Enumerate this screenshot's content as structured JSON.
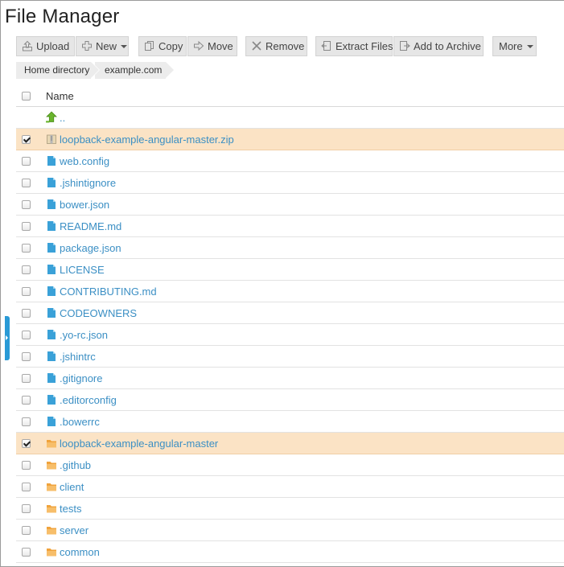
{
  "title": "File Manager",
  "toolbar": {
    "upload": "Upload",
    "new": "New",
    "copy": "Copy",
    "move": "Move",
    "remove": "Remove",
    "extract": "Extract Files",
    "archive": "Add to Archive",
    "more": "More"
  },
  "breadcrumb": [
    "Home directory",
    "example.com"
  ],
  "table": {
    "header_name": "Name",
    "parent": ".."
  },
  "files": [
    {
      "name": "loopback-example-angular-master.zip",
      "type": "zip",
      "selected": true
    },
    {
      "name": "web.config",
      "type": "file",
      "selected": false
    },
    {
      "name": ".jshintignore",
      "type": "file",
      "selected": false
    },
    {
      "name": "bower.json",
      "type": "file",
      "selected": false
    },
    {
      "name": "README.md",
      "type": "file",
      "selected": false
    },
    {
      "name": "package.json",
      "type": "file",
      "selected": false
    },
    {
      "name": "LICENSE",
      "type": "file",
      "selected": false
    },
    {
      "name": "CONTRIBUTING.md",
      "type": "file",
      "selected": false
    },
    {
      "name": "CODEOWNERS",
      "type": "file",
      "selected": false
    },
    {
      "name": ".yo-rc.json",
      "type": "file",
      "selected": false
    },
    {
      "name": ".jshintrc",
      "type": "file",
      "selected": false
    },
    {
      "name": ".gitignore",
      "type": "file",
      "selected": false
    },
    {
      "name": ".editorconfig",
      "type": "file",
      "selected": false
    },
    {
      "name": ".bowerrc",
      "type": "file",
      "selected": false
    },
    {
      "name": "loopback-example-angular-master",
      "type": "folder",
      "selected": true
    },
    {
      "name": ".github",
      "type": "folder",
      "selected": false
    },
    {
      "name": "client",
      "type": "folder",
      "selected": false
    },
    {
      "name": "tests",
      "type": "folder",
      "selected": false
    },
    {
      "name": "server",
      "type": "folder",
      "selected": false
    },
    {
      "name": "common",
      "type": "folder",
      "selected": false
    }
  ],
  "colors": {
    "link": "#3b8fc4",
    "selected_row": "#fbe3c5",
    "file_icon": "#3aa1d8",
    "folder_icon": "#f0a33c",
    "up_icon": "#6ab52d",
    "side_tab": "#2a9ad6"
  }
}
